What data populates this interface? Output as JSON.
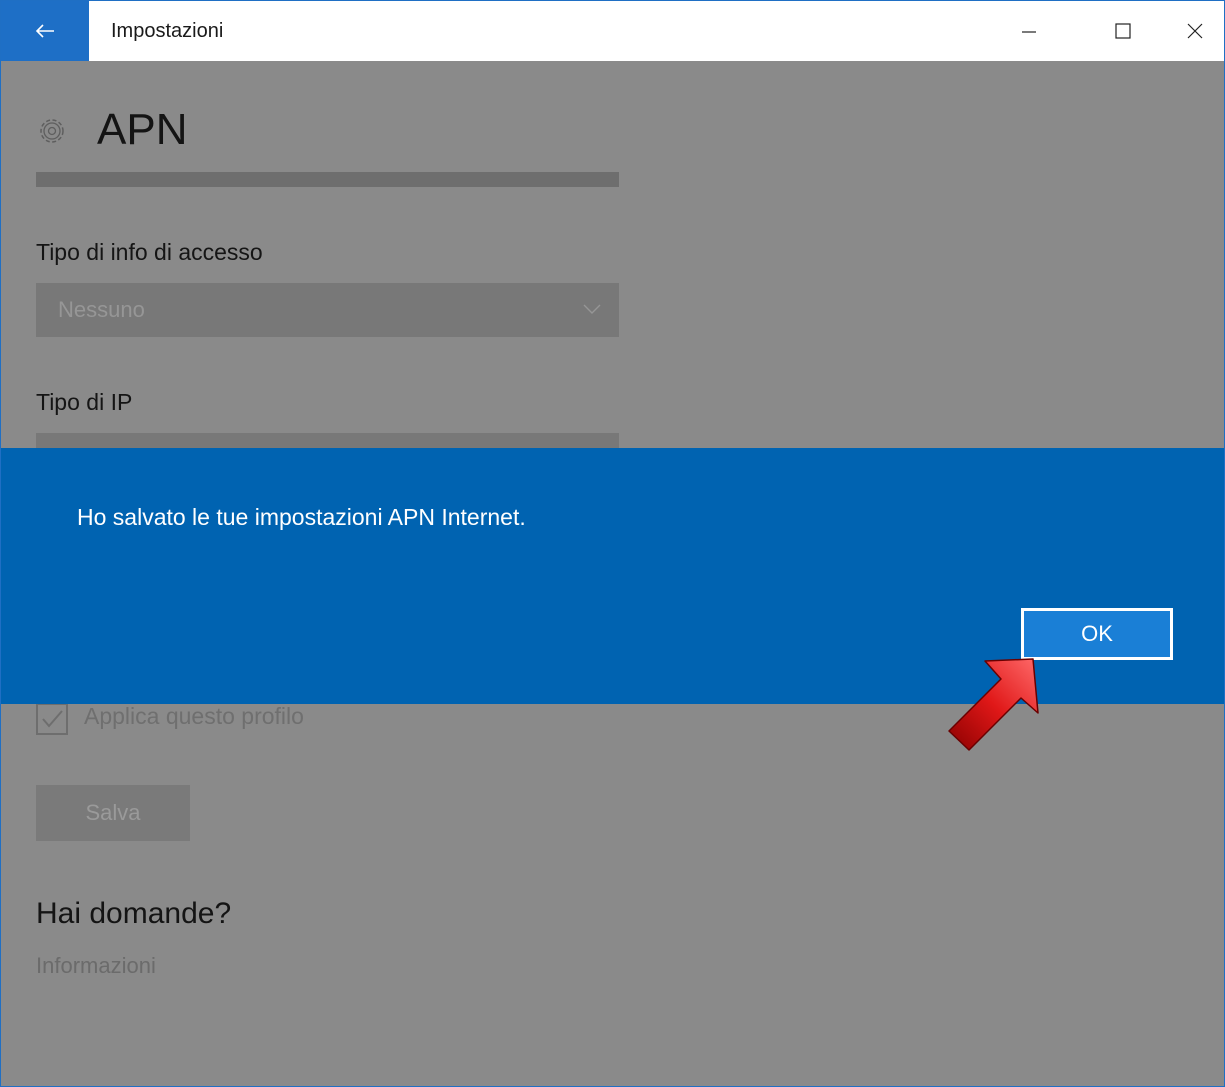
{
  "window": {
    "title": "Impostazioni",
    "accent_color": "#1e6fc6"
  },
  "icons": {
    "back": "back-arrow-icon",
    "minimize": "minimize-icon",
    "maximize": "maximize-icon",
    "close": "close-icon",
    "settings": "gear-icon",
    "dropdown": "chevron-down-icon",
    "checkbox": "checkmark-icon",
    "pointer": "red-arrow-icon"
  },
  "page": {
    "title": "APN",
    "login_type_label": "Tipo di info di accesso",
    "login_type_value": "Nessuno",
    "ip_type_label": "Tipo di IP",
    "apply_profile_label": "Applica questo profilo",
    "apply_profile_checked": true,
    "save_label": "Salva",
    "help_title": "Hai domande?",
    "help_link": "Informazioni"
  },
  "dialog": {
    "message": "Ho salvato le tue impostazioni APN Internet.",
    "ok_label": "OK",
    "background_color": "#0063b1"
  }
}
